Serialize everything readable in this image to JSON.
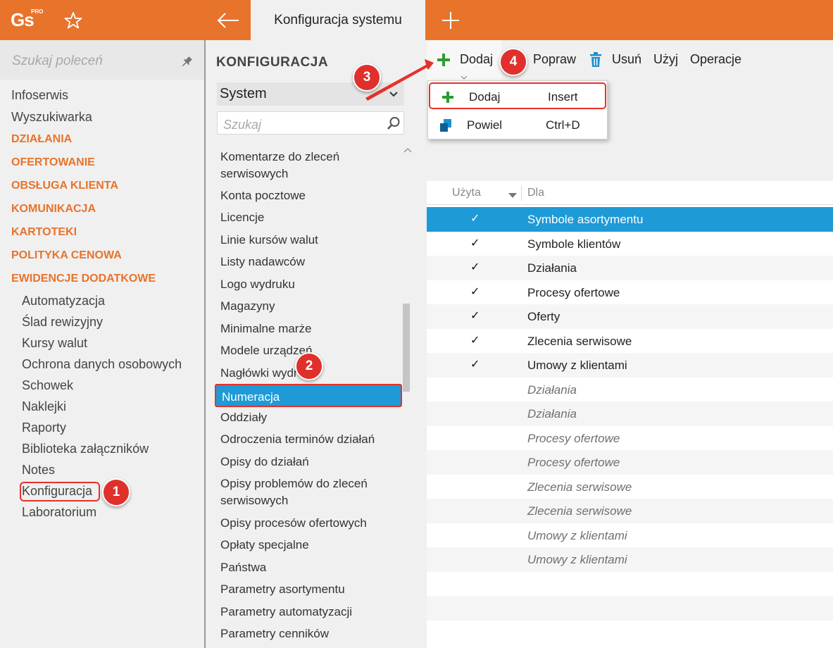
{
  "app": {
    "logo_text": "Gs",
    "logo_superscript": "PRO",
    "active_tab": "Konfiguracja systemu",
    "accent_color": "#e8732a",
    "selection_color": "#1e9ad6",
    "highlight_color": "#e6312a"
  },
  "sidebar": {
    "search_placeholder": "Szukaj poleceń",
    "top_items": [
      "Infoserwis",
      "Wyszukiwarka"
    ],
    "categories": [
      "DZIAŁANIA",
      "OFERTOWANIE",
      "OBSŁUGA KLIENTA",
      "KOMUNIKACJA",
      "KARTOTEKI",
      "POLITYKA CENOWA",
      "EWIDENCJE DODATKOWE"
    ],
    "sub_items": [
      "Automatyzacja",
      "Ślad rewizyjny",
      "Kursy walut",
      "Ochrona danych osobowych",
      "Schowek",
      "Naklejki",
      "Raporty",
      "Biblioteka załączników",
      "Notes",
      "Konfiguracja",
      "Laboratorium"
    ]
  },
  "config_panel": {
    "title": "KONFIGURACJA",
    "select_value": "System",
    "search_placeholder": "Szukaj",
    "items": [
      "Komentarze do zleceń serwisowych",
      "Konta pocztowe",
      "Licencje",
      "Linie kursów walut",
      "Listy nadawców",
      "Logo wydruku",
      "Magazyny",
      "Minimalne marże",
      "Modele urządzeń",
      "Nagłówki wydruku",
      "Numeracja",
      "Oddziały",
      "Odroczenia terminów działań",
      "Opisy do działań",
      "Opisy problemów do zleceń serwisowych",
      "Opisy procesów ofertowych",
      "Opłaty specjalne",
      "Państwa",
      "Parametry asortymentu",
      "Parametry automatyzacji",
      "Parametry cenników"
    ],
    "selected_item": "Numeracja"
  },
  "toolbar": {
    "add_label": "Dodaj",
    "edit_label": "Popraw",
    "delete_label": "Usuń",
    "use_label": "Użyj",
    "operations_label": "Operacje"
  },
  "add_dropdown": {
    "items": [
      {
        "label": "Dodaj",
        "shortcut": "Insert",
        "icon": "plus-icon"
      },
      {
        "label": "Powiel",
        "shortcut": "Ctrl+D",
        "icon": "duplicate-icon"
      }
    ]
  },
  "grid": {
    "columns": [
      "Użyta",
      "Dla"
    ],
    "check_mark": "✓",
    "rows": [
      {
        "used": true,
        "dla": "Symbole asortymentu",
        "selected": true
      },
      {
        "used": true,
        "dla": "Symbole klientów"
      },
      {
        "used": true,
        "dla": "Działania"
      },
      {
        "used": true,
        "dla": "Procesy ofertowe"
      },
      {
        "used": true,
        "dla": "Oferty"
      },
      {
        "used": true,
        "dla": "Zlecenia serwisowe"
      },
      {
        "used": true,
        "dla": "Umowy z klientami"
      },
      {
        "used": false,
        "dla": "Działania"
      },
      {
        "used": false,
        "dla": "Działania"
      },
      {
        "used": false,
        "dla": "Procesy ofertowe"
      },
      {
        "used": false,
        "dla": "Procesy ofertowe"
      },
      {
        "used": false,
        "dla": "Zlecenia serwisowe"
      },
      {
        "used": false,
        "dla": "Zlecenia serwisowe"
      },
      {
        "used": false,
        "dla": "Umowy z klientami"
      },
      {
        "used": false,
        "dla": "Umowy z klientami"
      },
      {
        "used": false,
        "dla": ""
      },
      {
        "used": false,
        "dla": ""
      },
      {
        "used": false,
        "dla": ""
      }
    ]
  },
  "annotations": {
    "badges": [
      "1",
      "2",
      "3",
      "4"
    ]
  }
}
